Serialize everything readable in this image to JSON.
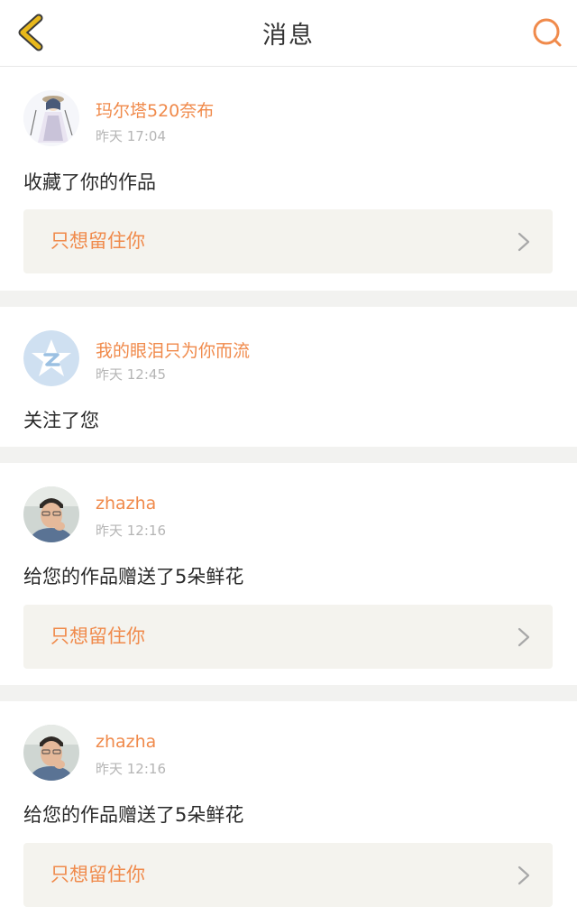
{
  "header": {
    "title": "消息"
  },
  "colors": {
    "accent": "#f08a4b",
    "back_arrow": "#e8b81c",
    "text": "#2a2a2a",
    "muted": "#b5b5b5",
    "card_bg": "#f4f3ee",
    "separator": "#f2f2f0"
  },
  "messages": [
    {
      "user": "玛尔塔520奈布",
      "time": "昨天 17:04",
      "action": "收藏了你的作品",
      "work_title": "只想留住你",
      "avatar_icon": "anime-girl-avatar"
    },
    {
      "user": "我的眼泪只为你而流",
      "time": "昨天 12:45",
      "action": "关注了您",
      "avatar_icon": "qzone-star-avatar"
    },
    {
      "user": "zhazha",
      "time": "昨天 12:16",
      "action": "给您的作品赠送了5朵鲜花",
      "work_title": "只想留住你",
      "avatar_icon": "man-photo-avatar"
    },
    {
      "user": "zhazha",
      "time": "昨天 12:16",
      "action": "给您的作品赠送了5朵鲜花",
      "work_title": "只想留住你",
      "avatar_icon": "man-photo-avatar"
    }
  ]
}
